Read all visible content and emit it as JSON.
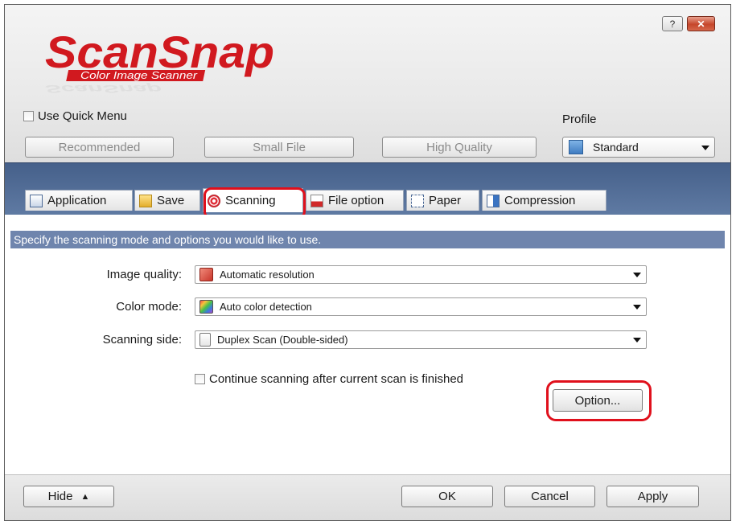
{
  "window": {
    "help_glyph": "?",
    "close_glyph": "✕",
    "logo_main": "ScanSnap",
    "logo_sub": "Color Image Scanner"
  },
  "header": {
    "quick_menu_label": "Use Quick Menu",
    "quick_menu_checked": false,
    "profile_label": "Profile",
    "presets": [
      "Recommended",
      "Small File",
      "High Quality"
    ],
    "profile_value": "Standard"
  },
  "tabs": [
    {
      "label": "Application",
      "icon": "application-icon"
    },
    {
      "label": "Save",
      "icon": "folder-icon"
    },
    {
      "label": "Scanning",
      "icon": "scanning-icon",
      "active": true
    },
    {
      "label": "File option",
      "icon": "pdf-icon"
    },
    {
      "label": "Paper",
      "icon": "paper-icon"
    },
    {
      "label": "Compression",
      "icon": "compression-icon"
    }
  ],
  "content": {
    "description": "Specify the scanning mode and options you would like to use.",
    "fields": [
      {
        "label": "Image quality:",
        "value": "Automatic resolution"
      },
      {
        "label": "Color mode:",
        "value": "Auto color detection"
      },
      {
        "label": "Scanning side:",
        "value": "Duplex Scan (Double-sided)"
      }
    ],
    "continue_label": "Continue scanning after current scan is finished",
    "continue_checked": false,
    "option_button": "Option..."
  },
  "footer": {
    "hide": "Hide",
    "ok": "OK",
    "cancel": "Cancel",
    "apply": "Apply"
  },
  "colors": {
    "accent_blue": "#5f7aa3",
    "description_bar": "#6f85ad",
    "highlight_red": "#e0101c",
    "logo_red": "#d1191f"
  }
}
